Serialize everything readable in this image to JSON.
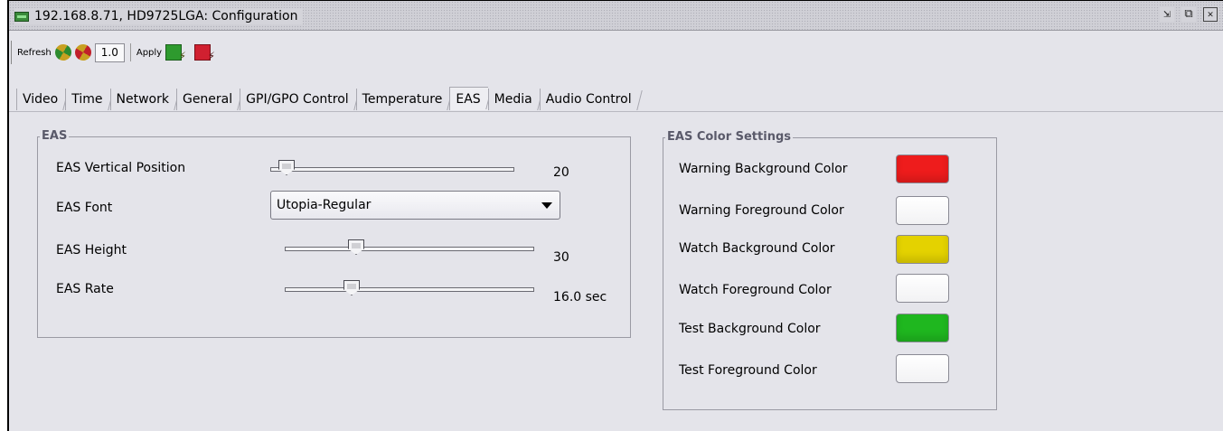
{
  "window": {
    "title": "192.168.8.71, HD9725LGA: Configuration",
    "icon": "device-icon",
    "controls": [
      "restore-icon",
      "maximize-icon",
      "close-icon"
    ]
  },
  "toolbar": {
    "refresh_label": "Refresh",
    "refresh_value": "1.0",
    "apply_label": "Apply"
  },
  "tabs": [
    {
      "label": "Video"
    },
    {
      "label": "Time"
    },
    {
      "label": "Network"
    },
    {
      "label": "General"
    },
    {
      "label": "GPI/GPO Control"
    },
    {
      "label": "Temperature"
    },
    {
      "label": "EAS",
      "active": true
    },
    {
      "label": "Media"
    },
    {
      "label": "Audio Control"
    }
  ],
  "eas": {
    "legend": "EAS",
    "vertical_position": {
      "label": "EAS Vertical Position",
      "value": "20",
      "level": 0.03
    },
    "font": {
      "label": "EAS Font",
      "selected": "Utopia-Regular"
    },
    "height": {
      "label": "EAS Height",
      "value": "30",
      "level": 0.27
    },
    "rate": {
      "label": "EAS Rate",
      "value": "16.0 sec",
      "level": 0.25
    }
  },
  "colors": {
    "legend": "EAS Color Settings",
    "items": [
      {
        "label": "Warning Background Color",
        "color": "#ee1c1c"
      },
      {
        "label": "Warning Foreground Color",
        "color": "#ffffff"
      },
      {
        "label": "Watch Background Color",
        "color": "#e4d200"
      },
      {
        "label": "Watch Foreground Color",
        "color": "#ffffff"
      },
      {
        "label": "Test Background Color",
        "color": "#1fb71f"
      },
      {
        "label": "Test Foreground Color",
        "color": "#ffffff"
      }
    ]
  }
}
